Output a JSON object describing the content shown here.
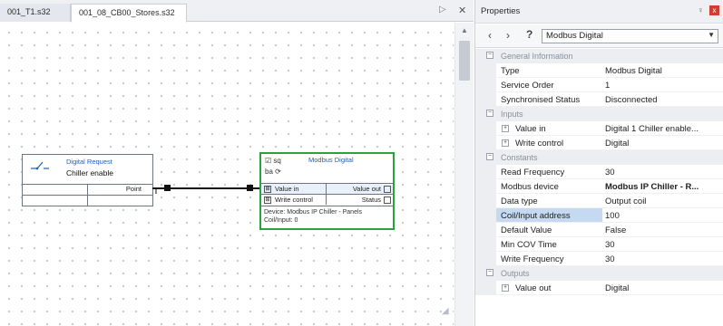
{
  "editor": {
    "tabs": [
      {
        "label": "001_T1.s32"
      },
      {
        "label": "001_08_CB00_Stores.s32"
      }
    ],
    "tab_scroll_glyph": "▷",
    "tab_close_glyph": "✕"
  },
  "blocks": {
    "digital_request": {
      "title": "Digital Request",
      "name": "Chiller enable",
      "output_label": "Point",
      "icon": "toggle-switch-icon"
    },
    "modbus_digital": {
      "title": "Modbus Digital",
      "icon_line1": "☑ sq",
      "icon_line2": "ba ⟳",
      "row1_left": "Value in",
      "row1_right": "Value out",
      "row2_left": "Write control",
      "row2_right": "Status",
      "footer_line1": "Device: Modbus IP Chiller - Panels",
      "footer_line2": "Coil/Input: 0",
      "border_color": "#2aa33d"
    }
  },
  "properties": {
    "title": "Properties",
    "pin_glyph": "♀",
    "close_glyph": "x",
    "selected_object": "Modbus Digital",
    "categories": [
      {
        "label": "General Information",
        "items": [
          {
            "name": "Type",
            "value": "Modbus Digital"
          },
          {
            "name": "Service Order",
            "value": "1"
          },
          {
            "name": "Synchronised Status",
            "value": "Disconnected"
          }
        ]
      },
      {
        "label": "Inputs",
        "items": [
          {
            "name": "Value in",
            "value": "Digital 1 Chiller enable..."
          },
          {
            "name": "Write control",
            "value": "Digital"
          }
        ]
      },
      {
        "label": "Constants",
        "items": [
          {
            "name": "Read Frequency",
            "value": "30"
          },
          {
            "name": "Modbus device",
            "value": "Modbus IP Chiller - R..."
          },
          {
            "name": "Data type",
            "value": "Output coil"
          },
          {
            "name": "Coil/Input address",
            "value": "100"
          },
          {
            "name": "Default Value",
            "value": "False"
          },
          {
            "name": "Min COV Time",
            "value": "30"
          },
          {
            "name": "Write Frequency",
            "value": "30"
          }
        ]
      },
      {
        "label": "Outputs",
        "items": [
          {
            "name": "Value out",
            "value": "Digital"
          }
        ]
      }
    ]
  }
}
